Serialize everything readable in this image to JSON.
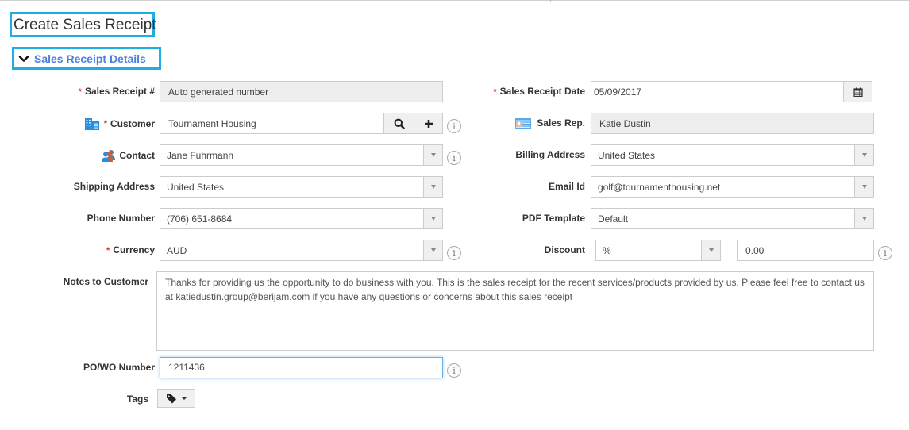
{
  "page": {
    "title": "Create Sales Receipt"
  },
  "section": {
    "title": "Sales Receipt Details",
    "expanded": true
  },
  "left_fields": {
    "sales_receipt_no": {
      "label": "Sales Receipt #",
      "required": true,
      "value": "Auto generated number",
      "readonly": true
    },
    "customer": {
      "label": "Customer",
      "required": true,
      "value": "Tournament Housing",
      "icon": "building-icon",
      "search_icon": "search-icon",
      "add_icon": "plus-icon"
    },
    "contact": {
      "label": "Contact",
      "value": "Jane Fuhrmann",
      "icon": "contacts-icon"
    },
    "shipping_address": {
      "label": "Shipping Address",
      "value": "United States"
    },
    "phone_number": {
      "label": "Phone Number",
      "value": "(706) 651-8684"
    },
    "currency": {
      "label": "Currency",
      "required": true,
      "value": "AUD"
    }
  },
  "right_fields": {
    "sales_receipt_date": {
      "label": "Sales Receipt Date",
      "required": true,
      "value": "05/09/2017",
      "icon": "calendar-icon"
    },
    "sales_rep": {
      "label": "Sales Rep.",
      "value": "Katie Dustin",
      "readonly": true,
      "icon": "id-card-icon"
    },
    "billing_address": {
      "label": "Billing Address",
      "value": "United States"
    },
    "email_id": {
      "label": "Email Id",
      "value": "golf@tournamenthousing.net"
    },
    "pdf_template": {
      "label": "PDF Template",
      "value": "Default"
    },
    "discount": {
      "label": "Discount",
      "type_value": "%",
      "amount": "0.00"
    }
  },
  "notes": {
    "label": "Notes to Customer",
    "value": "Thanks for providing us the opportunity to do business with you. This is the sales receipt for the recent services/products provided by us. Please feel free to contact us at katiedustin.group@berijam.com if you have any questions or concerns about this sales receipt"
  },
  "po_wo": {
    "label": "PO/WO Number",
    "value": "1211436"
  },
  "tags": {
    "label": "Tags",
    "icon": "tag-icon"
  },
  "required_marker": "*",
  "info_glyph": "i",
  "colors": {
    "accent_border": "#1eaee6",
    "section_title": "#4a7fe0",
    "required": "#e03030"
  }
}
